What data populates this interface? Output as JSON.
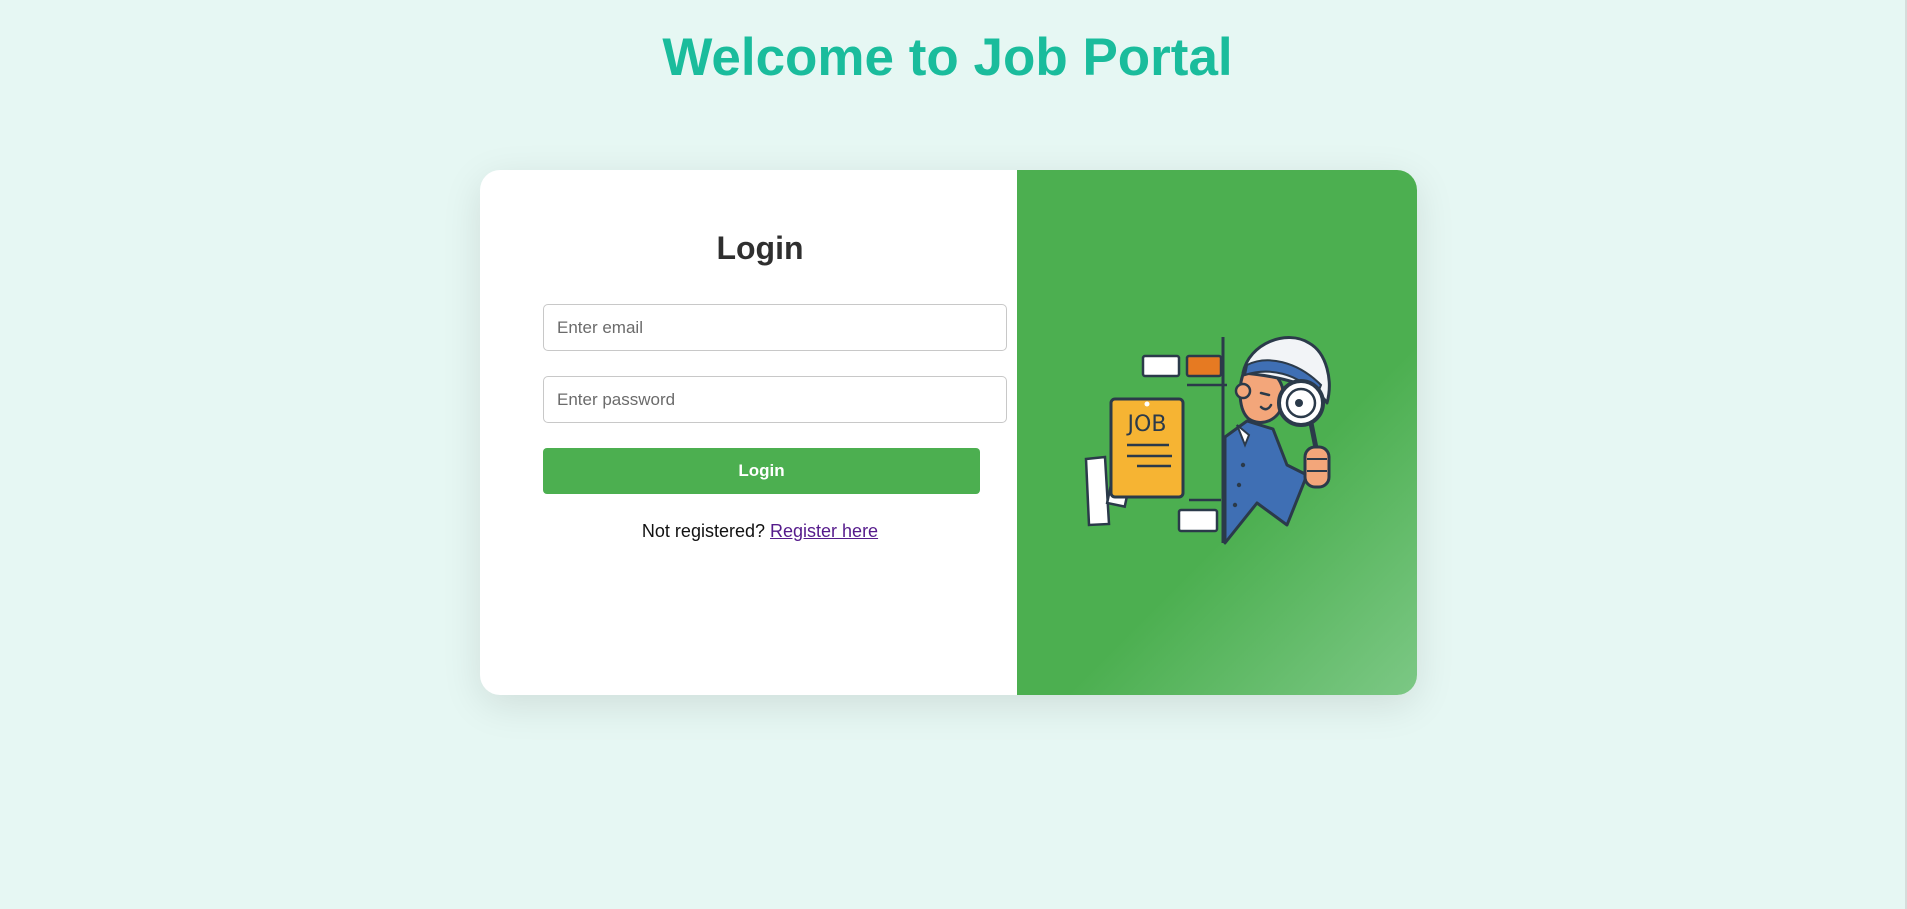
{
  "page": {
    "title": "Welcome to Job Portal"
  },
  "login_form": {
    "heading": "Login",
    "email_placeholder": "Enter email",
    "password_placeholder": "Enter password",
    "submit_label": "Login",
    "register_prompt": "Not registered?",
    "register_link": "Register here"
  },
  "illustration": {
    "icon": "detective-job-search-illustration",
    "sign_text": "JOB"
  },
  "colors": {
    "background": "#e6f7f3",
    "title": "#1abc9c",
    "accent": "#4caf50",
    "link": "#551a8b"
  }
}
